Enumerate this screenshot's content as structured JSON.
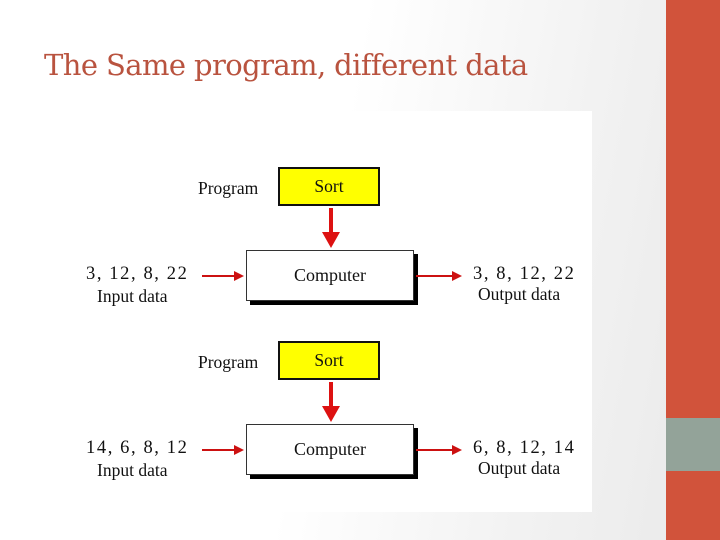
{
  "slide": {
    "title": "The Same program, different data"
  },
  "theme": {
    "title_color": "#b9533f",
    "sidebar_color": "#d1533b",
    "sidebar_accent_color": "#93a399",
    "arrow_color": "#dd1111",
    "program_box_color": "#ffff00"
  },
  "diagram": {
    "rows": [
      {
        "program_label": "Program",
        "program_name": "Sort",
        "computer_label": "Computer",
        "input_values": "3, 12, 8, 22",
        "input_caption": "Input data",
        "output_values": "3, 8, 12, 22",
        "output_caption": "Output data"
      },
      {
        "program_label": "Program",
        "program_name": "Sort",
        "computer_label": "Computer",
        "input_values": "14, 6, 8, 12",
        "input_caption": "Input data",
        "output_values": "6, 8, 12, 14",
        "output_caption": "Output data"
      }
    ]
  }
}
